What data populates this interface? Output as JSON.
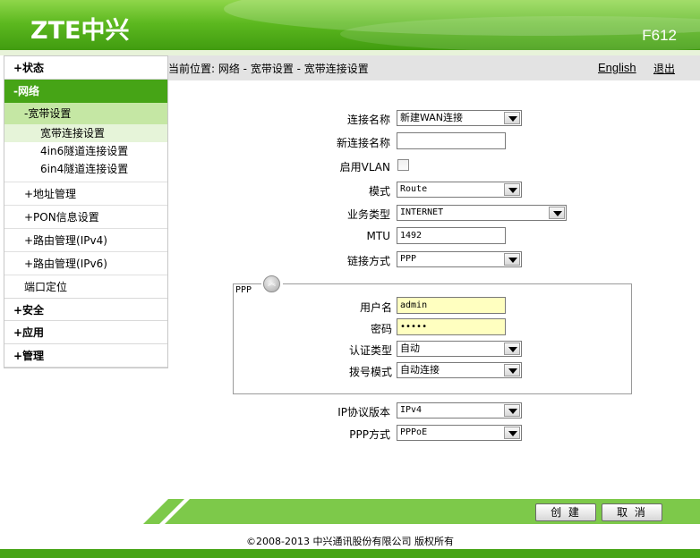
{
  "header": {
    "logo": "ZTE中兴",
    "model": "F612"
  },
  "breadcrumb": {
    "text": "当前位置: 网络 - 宽带设置 - 宽带连接设置",
    "language_link": "English",
    "logout_link": "退出"
  },
  "sidebar": {
    "status": "+状态",
    "network": "-网络",
    "broadband": "-宽带设置",
    "broadband_items": [
      "宽带连接设置",
      "4in6隧道连接设置",
      "6in4隧道连接设置"
    ],
    "address_mgmt": "+地址管理",
    "pon_info": "+PON信息设置",
    "route_ipv4": "+路由管理(IPv4)",
    "route_ipv6": "+路由管理(IPv6)",
    "port_locate": "端口定位",
    "security": "+安全",
    "application": "+应用",
    "management": "+管理"
  },
  "form": {
    "conn_name": {
      "label": "连接名称",
      "value": "新建WAN连接"
    },
    "new_conn_name": {
      "label": "新连接名称",
      "value": ""
    },
    "enable_vlan": {
      "label": "启用VLAN",
      "checked": false
    },
    "mode": {
      "label": "模式",
      "value": "Route"
    },
    "service_type": {
      "label": "业务类型",
      "value": "INTERNET"
    },
    "mtu": {
      "label": "MTU",
      "value": "1492"
    },
    "link_type": {
      "label": "链接方式",
      "value": "PPP"
    },
    "ppp_section": {
      "legend": "PPP",
      "username": {
        "label": "用户名",
        "value": "admin"
      },
      "password": {
        "label": "密码",
        "value": "•••••"
      },
      "auth_type": {
        "label": "认证类型",
        "value": "自动"
      },
      "dial_mode": {
        "label": "拨号模式",
        "value": "自动连接"
      }
    },
    "ip_version": {
      "label": "IP协议版本",
      "value": "IPv4"
    },
    "ppp_mode": {
      "label": "PPP方式",
      "value": "PPPoE"
    }
  },
  "buttons": {
    "create": "创 建",
    "cancel": "取 消"
  },
  "footer": {
    "copyright": "©2008-2013 中兴通讯股份有限公司 版权所有"
  }
}
